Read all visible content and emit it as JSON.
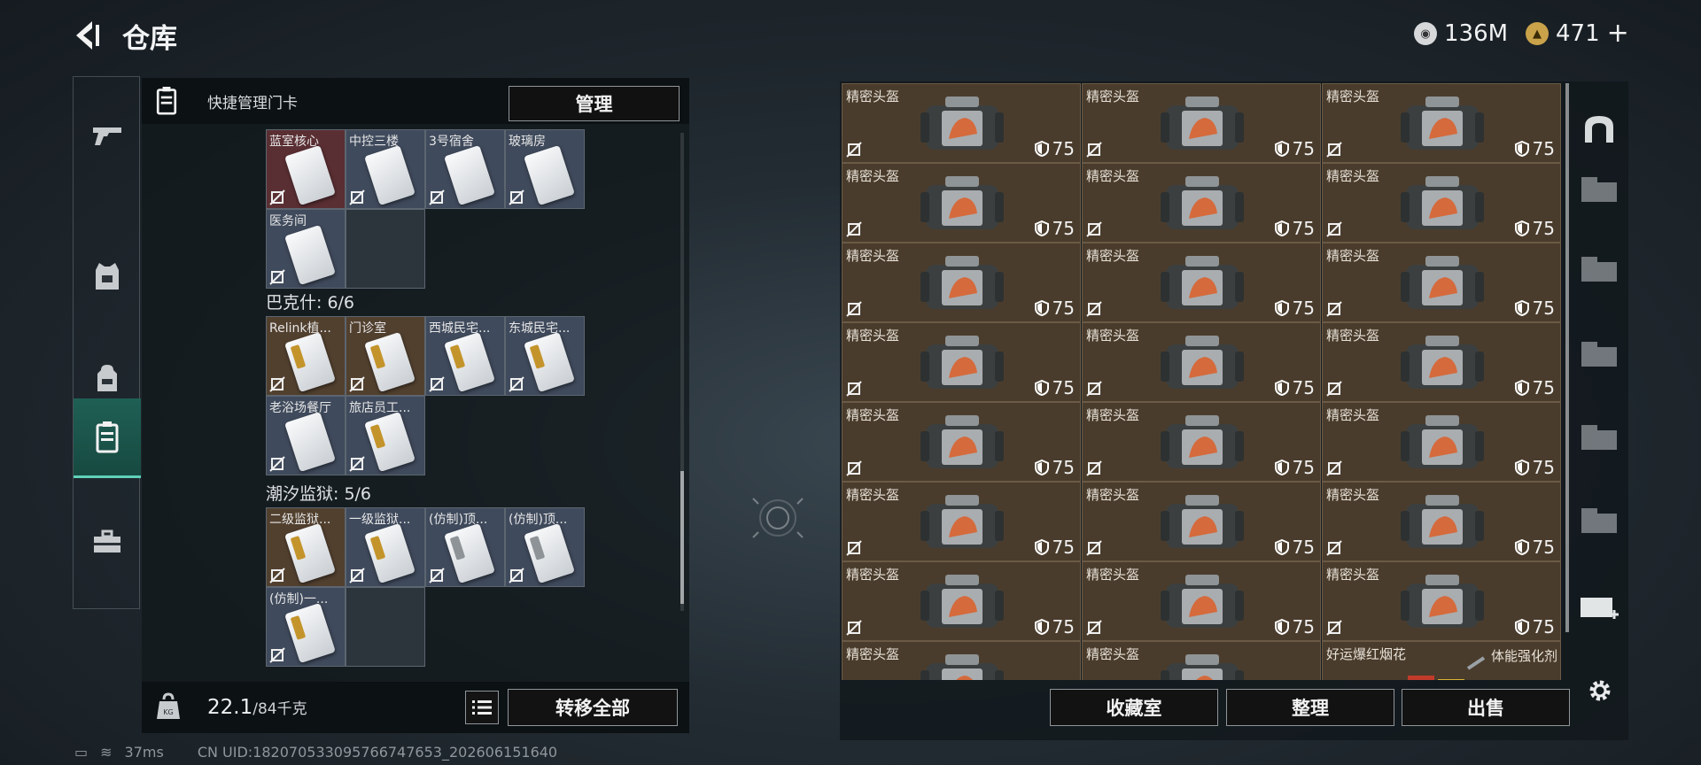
{
  "header": {
    "title": "仓库",
    "currency1": "136M",
    "currency2": "471"
  },
  "left_panel": {
    "header_label": "快捷管理门卡",
    "manage_btn": "管理",
    "sections": [
      {
        "title": "",
        "cards": [
          {
            "name": "蓝室核心",
            "tint": "red",
            "style": "white"
          },
          {
            "name": "中控三楼",
            "tint": "",
            "style": "white"
          },
          {
            "name": "3号宿舍",
            "tint": "",
            "style": "white"
          },
          {
            "name": "玻璃房",
            "tint": "",
            "style": "white"
          },
          {
            "name": "医务间",
            "tint": "",
            "style": "white"
          },
          {
            "name": "",
            "tint": "empty",
            "style": ""
          }
        ]
      },
      {
        "title": "巴克什: 6/6",
        "cards": [
          {
            "name": "Relink植...",
            "tint": "brown",
            "style": "gold"
          },
          {
            "name": "门诊室",
            "tint": "brown",
            "style": "gold"
          },
          {
            "name": "西城民宅...",
            "tint": "",
            "style": "gold"
          },
          {
            "name": "东城民宅...",
            "tint": "",
            "style": "gold"
          },
          {
            "name": "老浴场餐厅",
            "tint": "",
            "style": "white"
          },
          {
            "name": "旅店员工...",
            "tint": "",
            "style": "gold"
          }
        ]
      },
      {
        "title": "潮汐监狱: 5/6",
        "cards": [
          {
            "name": "二级监狱...",
            "tint": "brown",
            "style": "gold"
          },
          {
            "name": "一级监狱...",
            "tint": "",
            "style": "gold"
          },
          {
            "name": "(仿制)顶...",
            "tint": "",
            "style": "grey"
          },
          {
            "name": "(仿制)顶...",
            "tint": "",
            "style": "grey"
          },
          {
            "name": "(仿制)一...",
            "tint": "",
            "style": "gold"
          },
          {
            "name": "",
            "tint": "empty",
            "style": ""
          }
        ]
      }
    ],
    "weight_value": "22.1",
    "weight_max": "/84千克",
    "transfer_all": "转移全部"
  },
  "right_panel": {
    "items": [
      {
        "name": "精密头盔",
        "value": "75"
      },
      {
        "name": "精密头盔",
        "value": "75"
      },
      {
        "name": "精密头盔",
        "value": "75"
      },
      {
        "name": "精密头盔",
        "value": "75"
      },
      {
        "name": "精密头盔",
        "value": "75"
      },
      {
        "name": "精密头盔",
        "value": "75"
      },
      {
        "name": "精密头盔",
        "value": "75"
      },
      {
        "name": "精密头盔",
        "value": "75"
      },
      {
        "name": "精密头盔",
        "value": "75"
      },
      {
        "name": "精密头盔",
        "value": "75"
      },
      {
        "name": "精密头盔",
        "value": "75"
      },
      {
        "name": "精密头盔",
        "value": "75"
      },
      {
        "name": "精密头盔",
        "value": "75"
      },
      {
        "name": "精密头盔",
        "value": "75"
      },
      {
        "name": "精密头盔",
        "value": "75"
      },
      {
        "name": "精密头盔",
        "value": "75"
      },
      {
        "name": "精密头盔",
        "value": "75"
      },
      {
        "name": "精密头盔",
        "value": "75"
      },
      {
        "name": "精密头盔",
        "value": "75"
      },
      {
        "name": "精密头盔",
        "value": "75"
      },
      {
        "name": "精密头盔",
        "value": "75"
      },
      {
        "name": "精密头盔",
        "value": ""
      },
      {
        "name": "精密头盔",
        "value": ""
      },
      {
        "name": "好运爆红烟花",
        "value": ""
      }
    ],
    "extra_label": "体能强化剂",
    "buttons": [
      "收藏室",
      "整理",
      "出售"
    ]
  },
  "status_bar": {
    "ping": "37ms",
    "uid": "CN UID:1820705330957667476​53_202606151640"
  },
  "colors": {
    "accent": "#5fd1b8",
    "item_bg": "#4a3c2c"
  }
}
